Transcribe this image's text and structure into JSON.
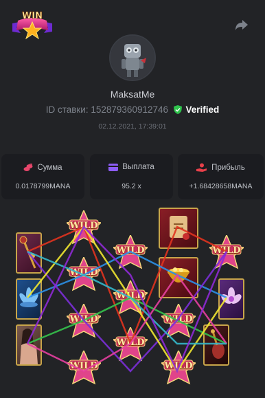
{
  "header": {
    "logo_text": "WIN",
    "share_icon": "share-arrow-icon"
  },
  "profile": {
    "username": "MaksatMe",
    "bet_id_label": "ID ставки:",
    "bet_id": "152879360912746",
    "verified_label": "Verified",
    "datetime": "02.12.2021, 17:39:01"
  },
  "stats": [
    {
      "label": "Сумма",
      "value": "0.0178799MANA",
      "icon": "coins-icon",
      "color": "#e8466b"
    },
    {
      "label": "Выплата",
      "value": "95.2 x",
      "icon": "wallet-icon",
      "color": "#8d5cf6"
    },
    {
      "label": "Прибыль",
      "value": "+1.68428658MANA",
      "icon": "profit-hand-icon",
      "color": "#e8404a"
    }
  ],
  "board": {
    "wild_label": "WILD",
    "line_colors": [
      "#e0331f",
      "#2b8fe5",
      "#35c24d",
      "#7b2fd8",
      "#f0e531",
      "#e63fa0",
      "#34b6c9",
      "#8d2ad4"
    ]
  }
}
